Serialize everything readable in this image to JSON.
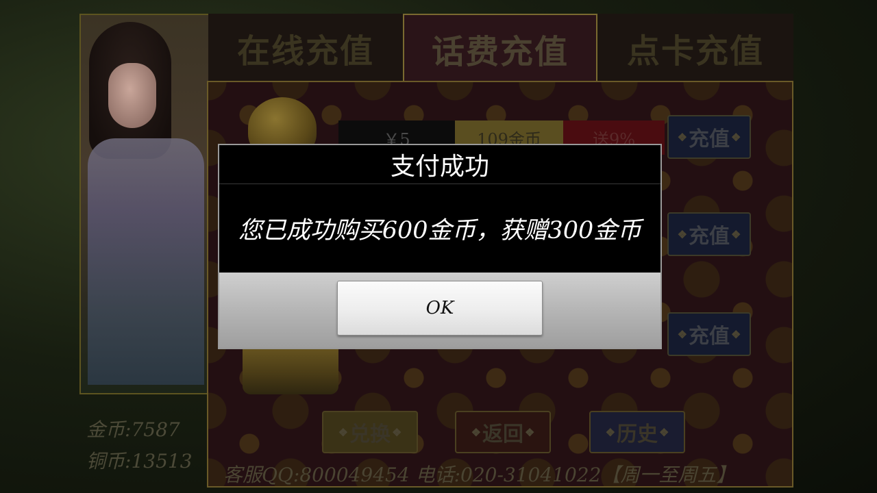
{
  "tabs": [
    {
      "label": "在线充值"
    },
    {
      "label": "话费充值"
    },
    {
      "label": "点卡充值"
    }
  ],
  "active_tab": "话费充值",
  "balances": {
    "gold_label": "金币:",
    "gold_value": "7587",
    "copper_label": "铜币:",
    "copper_value": "13513"
  },
  "price_row": {
    "price": "￥5",
    "gold": "109金币",
    "bonus": "送9%"
  },
  "recharge_label": "充值",
  "recharge_buttons": [
    "充值",
    "充值",
    "充值"
  ],
  "bottom_buttons": {
    "exchange": "兑换",
    "back": "返回",
    "history": "历史"
  },
  "footer": "客服QQ:800049454 电话:020-31041022【周一至周五】",
  "dialog": {
    "title": "支付成功",
    "message": "您已成功购买600金币，获赠300金币",
    "ok_label": "OK"
  },
  "colors": {
    "panel_bg": "#230f12",
    "frame_gold": "#6a5a28",
    "recharge_blue": "#141a2e",
    "dialog_bg": "#000000",
    "ok_button": "#ededed"
  },
  "icons": [
    "coin-bag-icon",
    "treasure-chest-icon",
    "ornament-icon"
  ]
}
